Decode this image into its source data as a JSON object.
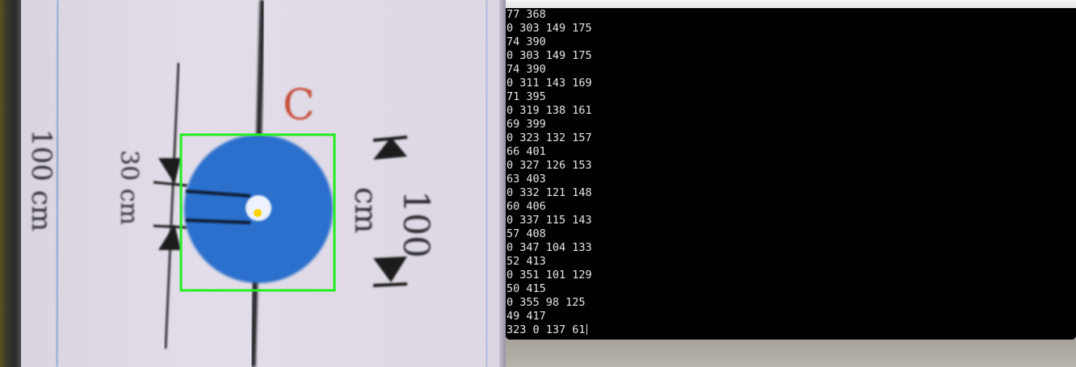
{
  "camera": {
    "labels": {
      "tracker_letter": "C",
      "diameter_value": "30 cm",
      "height_value": "100",
      "height_unit": "cm",
      "edge_value": "100 cm"
    },
    "colors": {
      "target_fill": "#2a6fcc",
      "bounding_box": "#22ee22",
      "centroid": "#ffd400"
    }
  },
  "terminal": {
    "lines": [
      "77 368",
      "0 303 149 175",
      "74 390",
      "0 303 149 175",
      "74 390",
      "0 311 143 169",
      "71 395",
      "0 319 138 161",
      "69 399",
      "0 323 132 157",
      "66 401",
      "0 327 126 153",
      "63 403",
      "0 332 121 148",
      "60 406",
      "0 337 115 143",
      "57 408",
      "0 347 104 133",
      "52 413",
      "0 351 101 129",
      "50 415",
      "0 355 98 125",
      "49 417",
      "323 0 137 61"
    ]
  }
}
